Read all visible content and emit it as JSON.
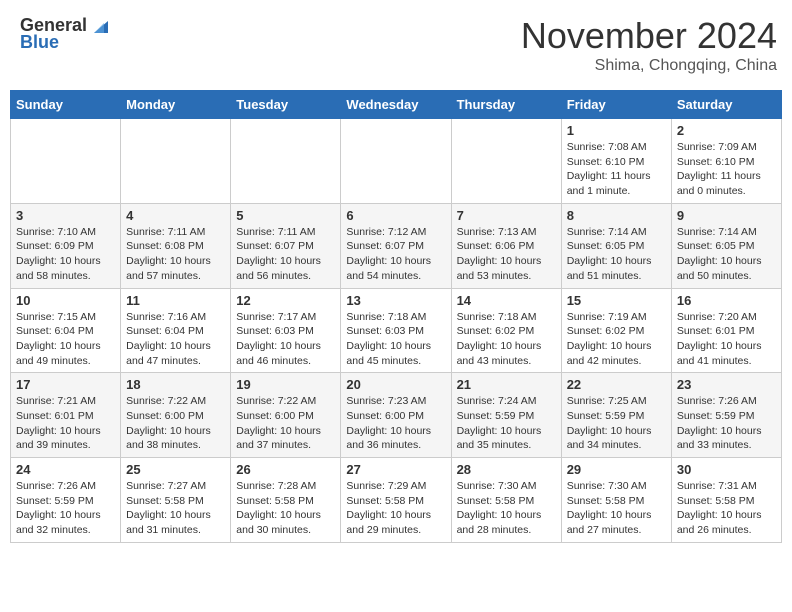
{
  "header": {
    "logo_general": "General",
    "logo_blue": "Blue",
    "month_title": "November 2024",
    "subtitle": "Shima, Chongqing, China"
  },
  "weekdays": [
    "Sunday",
    "Monday",
    "Tuesday",
    "Wednesday",
    "Thursday",
    "Friday",
    "Saturday"
  ],
  "weeks": [
    [
      {
        "day": "",
        "info": ""
      },
      {
        "day": "",
        "info": ""
      },
      {
        "day": "",
        "info": ""
      },
      {
        "day": "",
        "info": ""
      },
      {
        "day": "",
        "info": ""
      },
      {
        "day": "1",
        "info": "Sunrise: 7:08 AM\nSunset: 6:10 PM\nDaylight: 11 hours\nand 1 minute."
      },
      {
        "day": "2",
        "info": "Sunrise: 7:09 AM\nSunset: 6:10 PM\nDaylight: 11 hours\nand 0 minutes."
      }
    ],
    [
      {
        "day": "3",
        "info": "Sunrise: 7:10 AM\nSunset: 6:09 PM\nDaylight: 10 hours\nand 58 minutes."
      },
      {
        "day": "4",
        "info": "Sunrise: 7:11 AM\nSunset: 6:08 PM\nDaylight: 10 hours\nand 57 minutes."
      },
      {
        "day": "5",
        "info": "Sunrise: 7:11 AM\nSunset: 6:07 PM\nDaylight: 10 hours\nand 56 minutes."
      },
      {
        "day": "6",
        "info": "Sunrise: 7:12 AM\nSunset: 6:07 PM\nDaylight: 10 hours\nand 54 minutes."
      },
      {
        "day": "7",
        "info": "Sunrise: 7:13 AM\nSunset: 6:06 PM\nDaylight: 10 hours\nand 53 minutes."
      },
      {
        "day": "8",
        "info": "Sunrise: 7:14 AM\nSunset: 6:05 PM\nDaylight: 10 hours\nand 51 minutes."
      },
      {
        "day": "9",
        "info": "Sunrise: 7:14 AM\nSunset: 6:05 PM\nDaylight: 10 hours\nand 50 minutes."
      }
    ],
    [
      {
        "day": "10",
        "info": "Sunrise: 7:15 AM\nSunset: 6:04 PM\nDaylight: 10 hours\nand 49 minutes."
      },
      {
        "day": "11",
        "info": "Sunrise: 7:16 AM\nSunset: 6:04 PM\nDaylight: 10 hours\nand 47 minutes."
      },
      {
        "day": "12",
        "info": "Sunrise: 7:17 AM\nSunset: 6:03 PM\nDaylight: 10 hours\nand 46 minutes."
      },
      {
        "day": "13",
        "info": "Sunrise: 7:18 AM\nSunset: 6:03 PM\nDaylight: 10 hours\nand 45 minutes."
      },
      {
        "day": "14",
        "info": "Sunrise: 7:18 AM\nSunset: 6:02 PM\nDaylight: 10 hours\nand 43 minutes."
      },
      {
        "day": "15",
        "info": "Sunrise: 7:19 AM\nSunset: 6:02 PM\nDaylight: 10 hours\nand 42 minutes."
      },
      {
        "day": "16",
        "info": "Sunrise: 7:20 AM\nSunset: 6:01 PM\nDaylight: 10 hours\nand 41 minutes."
      }
    ],
    [
      {
        "day": "17",
        "info": "Sunrise: 7:21 AM\nSunset: 6:01 PM\nDaylight: 10 hours\nand 39 minutes."
      },
      {
        "day": "18",
        "info": "Sunrise: 7:22 AM\nSunset: 6:00 PM\nDaylight: 10 hours\nand 38 minutes."
      },
      {
        "day": "19",
        "info": "Sunrise: 7:22 AM\nSunset: 6:00 PM\nDaylight: 10 hours\nand 37 minutes."
      },
      {
        "day": "20",
        "info": "Sunrise: 7:23 AM\nSunset: 6:00 PM\nDaylight: 10 hours\nand 36 minutes."
      },
      {
        "day": "21",
        "info": "Sunrise: 7:24 AM\nSunset: 5:59 PM\nDaylight: 10 hours\nand 35 minutes."
      },
      {
        "day": "22",
        "info": "Sunrise: 7:25 AM\nSunset: 5:59 PM\nDaylight: 10 hours\nand 34 minutes."
      },
      {
        "day": "23",
        "info": "Sunrise: 7:26 AM\nSunset: 5:59 PM\nDaylight: 10 hours\nand 33 minutes."
      }
    ],
    [
      {
        "day": "24",
        "info": "Sunrise: 7:26 AM\nSunset: 5:59 PM\nDaylight: 10 hours\nand 32 minutes."
      },
      {
        "day": "25",
        "info": "Sunrise: 7:27 AM\nSunset: 5:58 PM\nDaylight: 10 hours\nand 31 minutes."
      },
      {
        "day": "26",
        "info": "Sunrise: 7:28 AM\nSunset: 5:58 PM\nDaylight: 10 hours\nand 30 minutes."
      },
      {
        "day": "27",
        "info": "Sunrise: 7:29 AM\nSunset: 5:58 PM\nDaylight: 10 hours\nand 29 minutes."
      },
      {
        "day": "28",
        "info": "Sunrise: 7:30 AM\nSunset: 5:58 PM\nDaylight: 10 hours\nand 28 minutes."
      },
      {
        "day": "29",
        "info": "Sunrise: 7:30 AM\nSunset: 5:58 PM\nDaylight: 10 hours\nand 27 minutes."
      },
      {
        "day": "30",
        "info": "Sunrise: 7:31 AM\nSunset: 5:58 PM\nDaylight: 10 hours\nand 26 minutes."
      }
    ]
  ]
}
